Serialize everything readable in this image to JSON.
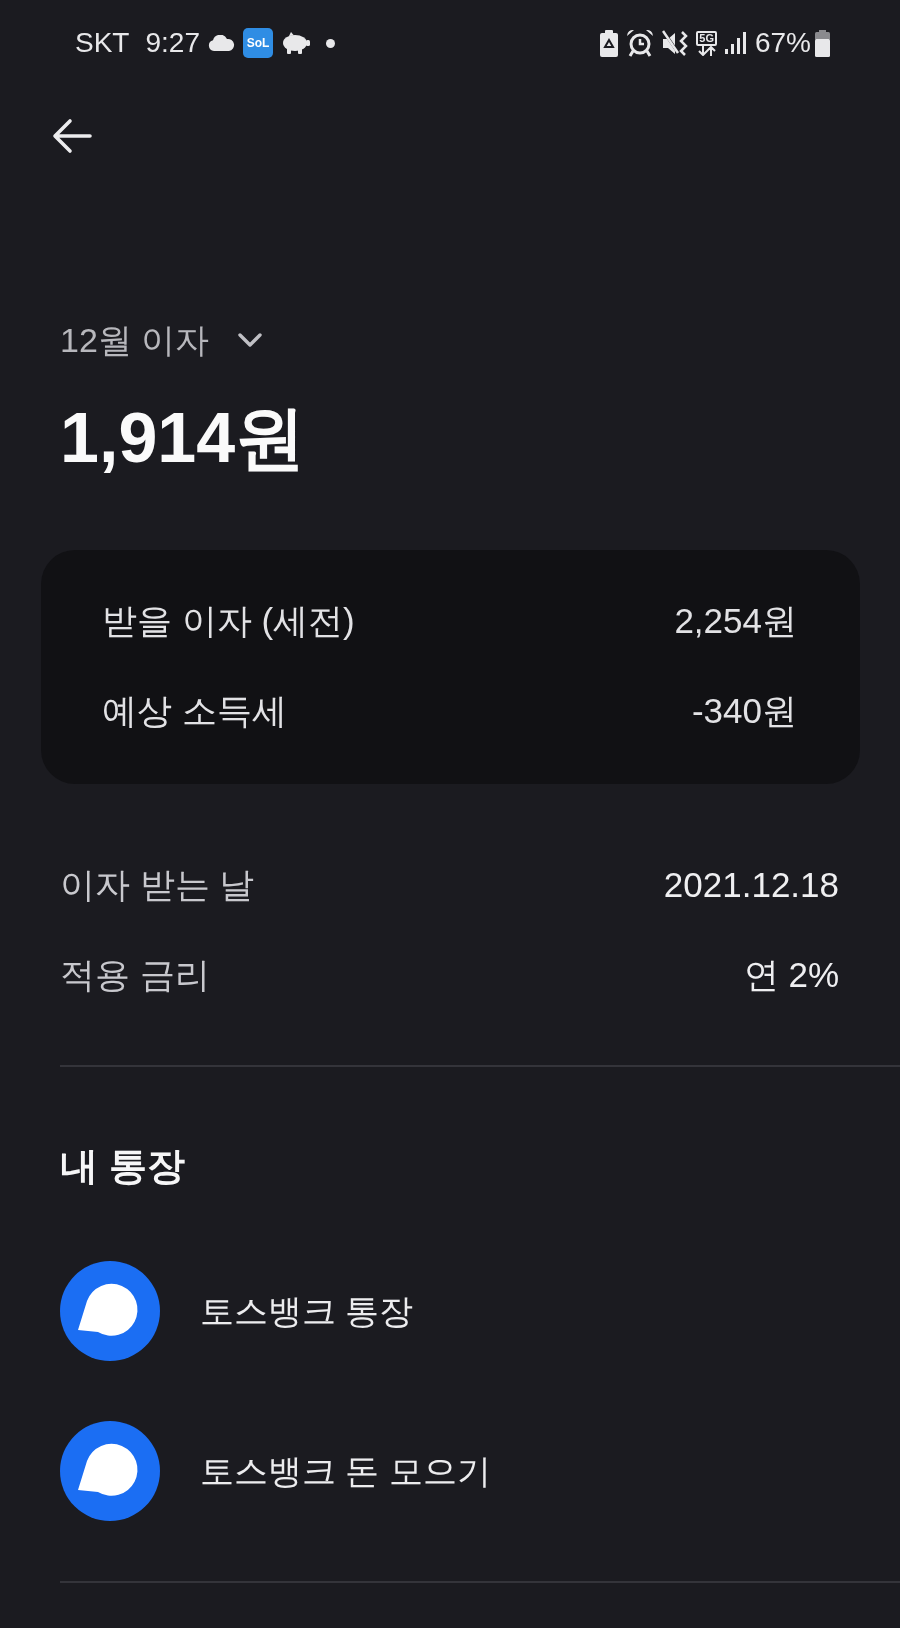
{
  "status_bar": {
    "carrier": "SKT",
    "time": "9:27",
    "app_icon_label": "SoL",
    "network_type": "5G",
    "battery_percent": "67%"
  },
  "header": {
    "period_label": "12월 이자",
    "amount": "1,914원"
  },
  "breakdown": [
    {
      "label": "받을 이자 (세전)",
      "value": "2,254원"
    },
    {
      "label": "예상 소득세",
      "value": "-340원"
    }
  ],
  "details": [
    {
      "label": "이자 받는 날",
      "value": "2021.12.18"
    },
    {
      "label": "적용 금리",
      "value": "연 2%"
    }
  ],
  "accounts": {
    "title": "내 통장",
    "items": [
      {
        "name": "토스뱅크 통장"
      },
      {
        "name": "토스뱅크 돈 모으기"
      }
    ]
  }
}
